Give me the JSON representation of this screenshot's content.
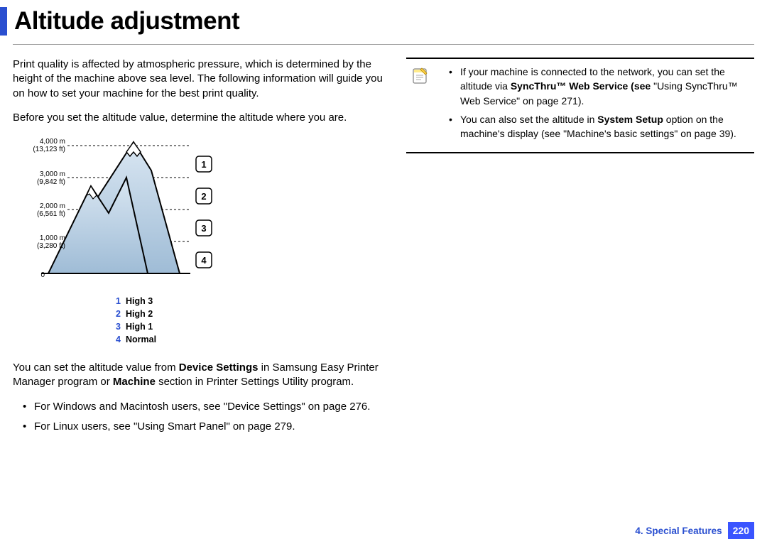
{
  "title": "Altitude adjustment",
  "p1": "Print quality is affected by atmospheric pressure, which is determined by the height of the machine above sea level. The following information will guide you on how to set your machine for the best print quality.",
  "p2": "Before you set the altitude value, determine the altitude where you are.",
  "diagram": {
    "levels": [
      {
        "m": "4,000 m",
        "ft": "(13,123 ft)"
      },
      {
        "m": "3,000 m",
        "ft": "(9,842 ft)"
      },
      {
        "m": "2,000 m",
        "ft": "(6,561 ft)"
      },
      {
        "m": "1,000 m",
        "ft": "(3,280 ft)"
      },
      {
        "m": "0",
        "ft": ""
      }
    ],
    "nums": [
      "1",
      "2",
      "3",
      "4"
    ],
    "legend": [
      {
        "n": "1",
        "label": "High 3"
      },
      {
        "n": "2",
        "label": "High 2"
      },
      {
        "n": "3",
        "label": "High 1"
      },
      {
        "n": "4",
        "label": "Normal"
      }
    ]
  },
  "p3a": "You can set the altitude value from ",
  "p3b": "Device Settings",
  "p3c": " in Samsung Easy Printer Manager program or ",
  "p3d": "Machine",
  "p3e": " section in Printer Settings Utility program.",
  "bullA": "For Windows and Macintosh users, see \"Device Settings\" on page 276.",
  "bullB": "For Linux users, see \"Using Smart Panel\" on page 279.",
  "note1a": "If your machine is connected to the network, you can set the altitude via ",
  "note1b": "SyncThru™ Web Service (see",
  "note1c": " \"Using SyncThru™ Web Service\" on page 271).",
  "note2a": "You can also set the altitude in ",
  "note2b": "System Setup",
  "note2c": " option on the machine's display (see \"Machine's basic settings\" on page 39).",
  "footer": {
    "chapter": "4.  Special Features",
    "page": "220"
  }
}
